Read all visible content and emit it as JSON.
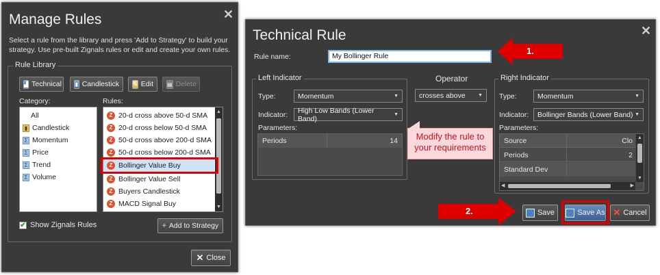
{
  "manage": {
    "title": "Manage Rules",
    "close_glyph": "✕",
    "description_line1": "Select a rule from the library and press 'Add to Strategy' to build your",
    "description_line2": "strategy. Use pre-built Zignals rules or edit and create your own rules.",
    "library_label": "Rule Library",
    "toolbar": {
      "technical": "Technical",
      "candlestick": "Candlestick",
      "edit": "Edit",
      "delete": "Delete"
    },
    "category_label": "Category:",
    "rules_label": "Rules:",
    "categories": [
      "All",
      "Candlestick",
      "Momentum",
      "Price",
      "Trend",
      "Volume"
    ],
    "rules": [
      "20-d cross above 50-d SMA",
      "20-d cross below 50-d SMA",
      "50-d cross above 200-d SMA",
      "50-d cross below 200-d SMA",
      "Bollinger Value Buy",
      "Bollinger Value Sell",
      "Buyers Candlestick",
      "MACD Signal Buy"
    ],
    "show_zignals": "Show Zignals Rules",
    "add_to_strategy": "Add to Strategy",
    "close_button": "Close"
  },
  "technical": {
    "title": "Technical Rule",
    "close_glyph": "✕",
    "rule_name_label": "Rule name:",
    "rule_name_value": "My Bollinger Rule",
    "left": {
      "label": "Left Indicator",
      "type_label": "Type:",
      "type_value": "Momentum",
      "indicator_label": "Indicator:",
      "indicator_value": "High Low Bands (Lower Band)",
      "parameters_label": "Parameters:",
      "params": [
        {
          "name": "Periods",
          "value": "14"
        }
      ]
    },
    "operator": {
      "label": "Operator",
      "value": "crosses above"
    },
    "right": {
      "label": "Right Indicator",
      "type_label": "Type:",
      "type_value": "Momentum",
      "indicator_label": "Indicator:",
      "indicator_value": "Bollinger Bands (Lower Band)",
      "parameters_label": "Parameters:",
      "params": [
        {
          "name": "Source",
          "value": "Clo"
        },
        {
          "name": "Periods",
          "value": "2"
        },
        {
          "name": "Standard Dev",
          "value": ""
        }
      ]
    },
    "callout_line1": "Modify the rule  to",
    "callout_line2": "your requirements",
    "step1": "1.",
    "step2": "2.",
    "save": "Save",
    "save_as": "Save As",
    "cancel": "Cancel"
  },
  "colors": {
    "dialog_bg": "#3a3a3a",
    "highlight_red": "#e00000",
    "callout_bg": "#fbd8dc",
    "selected_row": "#cfe3f7"
  }
}
